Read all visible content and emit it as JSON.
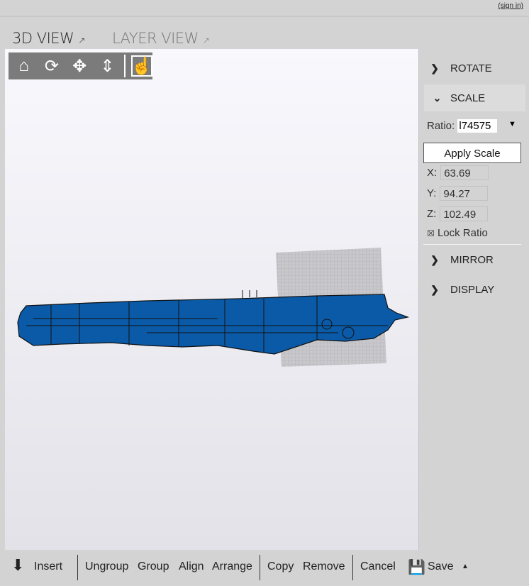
{
  "header": {
    "sign_in": "(sign in)"
  },
  "tabs": [
    {
      "label": "3D VIEW",
      "icon": "external-link-icon"
    },
    {
      "label": "LAYER VIEW",
      "icon": "external-link-icon"
    }
  ],
  "toolbar": [
    "home-icon",
    "rotate-icon",
    "move-icon",
    "lift-icon",
    "select-touch-icon"
  ],
  "sidebar": {
    "rotate": "ROTATE",
    "scale": "SCALE",
    "ratio_label": "Ratio:",
    "ratio_value": "l74575",
    "apply": "Apply Scale",
    "x_label": "X:",
    "x": "63.69",
    "y_label": "Y:",
    "y": "94.27",
    "z_label": "Z:",
    "z": "102.49",
    "lock": "Lock Ratio",
    "lock_box": "☒",
    "mirror": "MIRROR",
    "display": "DISPLAY"
  },
  "bottom": {
    "insert": "Insert",
    "ungroup": "Ungroup",
    "group": "Group",
    "align": "Align",
    "arrange": "Arrange",
    "copy": "Copy",
    "remove": "Remove",
    "cancel": "Cancel",
    "save": "Save"
  },
  "colors": {
    "model": "#0a5aa8"
  }
}
